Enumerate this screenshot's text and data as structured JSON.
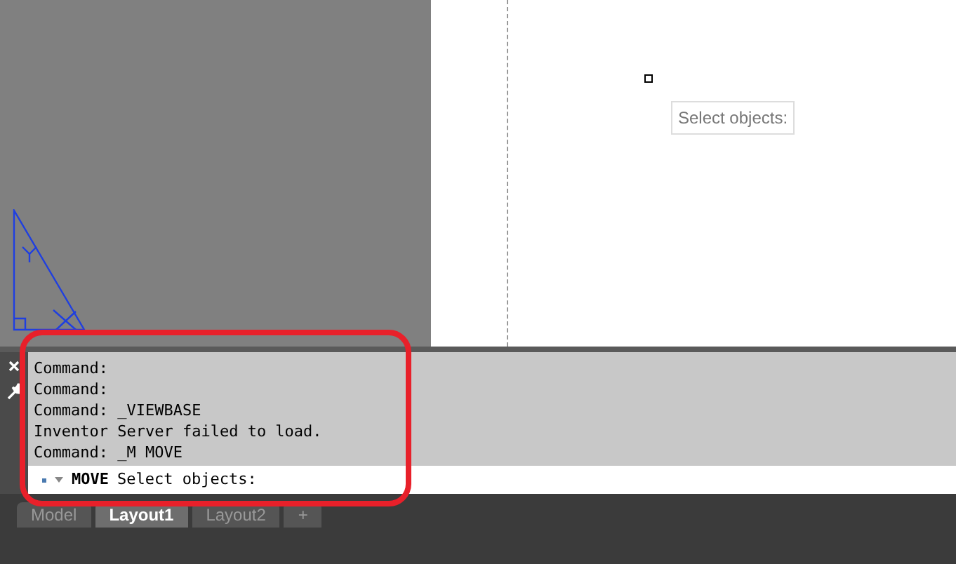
{
  "drawing_area": {
    "tooltip": "Select objects:"
  },
  "command_history": [
    "Command:",
    "Command:",
    "Command: _VIEWBASE",
    "Inventor Server failed to load.",
    "Command: _M MOVE"
  ],
  "command_line": {
    "command": "MOVE",
    "prompt": "Select objects:"
  },
  "layout_tabs": [
    {
      "label": "Model",
      "selected": false
    },
    {
      "label": "Layout1",
      "selected": true
    },
    {
      "label": "Layout2",
      "selected": false
    },
    {
      "label": "+",
      "selected": false
    }
  ]
}
